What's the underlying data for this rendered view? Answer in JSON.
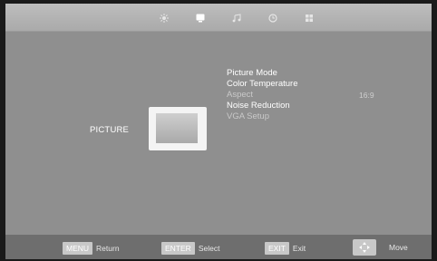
{
  "top_tabs": [
    {
      "icon": "sun-icon"
    },
    {
      "icon": "monitor-icon"
    },
    {
      "icon": "music-note-icon"
    },
    {
      "icon": "clock-icon"
    },
    {
      "icon": "grid-icon"
    }
  ],
  "section": {
    "label": "PICTURE",
    "icon": "picture-frame-icon"
  },
  "menu": {
    "items": [
      {
        "label": "Picture Mode",
        "enabled": true
      },
      {
        "label": "Color  Temperature",
        "enabled": true
      },
      {
        "label": "Aspect",
        "enabled": false,
        "value": "16:9"
      },
      {
        "label": "Noise  Reduction",
        "enabled": true
      },
      {
        "label": "VGA  Setup",
        "enabled": false
      }
    ]
  },
  "footer": {
    "menu_key": "MENU",
    "menu_text": "Return",
    "enter_key": "ENTER",
    "enter_text": "Select",
    "exit_key": "EXIT",
    "exit_text": "Exit",
    "move_icon": "dpad-icon",
    "move_text": "Move"
  },
  "colors": {
    "panel": "#8f8f8f",
    "text": "#ffffff",
    "disabled_text": "#c9c9c9"
  }
}
